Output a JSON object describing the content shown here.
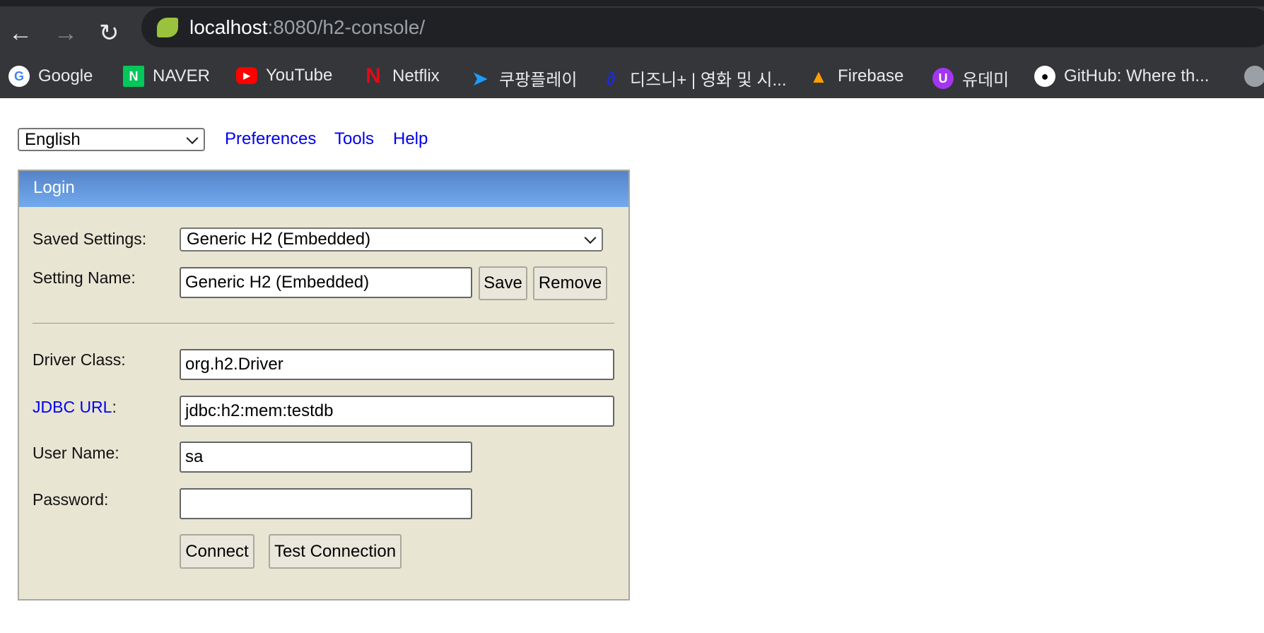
{
  "browser": {
    "url_host": "localhost",
    "url_rest": ":8080/h2-console/",
    "bookmarks": [
      {
        "label": "Google",
        "icon": "google-icon",
        "color": "#ffffff"
      },
      {
        "label": "NAVER",
        "icon": "naver-icon",
        "color": "#03c75a"
      },
      {
        "label": "YouTube",
        "icon": "youtube-icon",
        "color": "#ff0000"
      },
      {
        "label": "Netflix",
        "icon": "netflix-icon",
        "color": "#b20710"
      },
      {
        "label": "쿠팡플레이",
        "icon": "coupang-play-icon",
        "color": "#1e9bff"
      },
      {
        "label": "디즈니+ | 영화 및 시...",
        "icon": "disney-plus-icon",
        "color": "#1a2bd8"
      },
      {
        "label": "Firebase",
        "icon": "firebase-icon",
        "color": "#ffa000"
      },
      {
        "label": "유데미",
        "icon": "udemy-icon",
        "color": "#a435f0"
      },
      {
        "label": "GitHub: Where th...",
        "icon": "github-icon",
        "color": "#ffffff"
      }
    ]
  },
  "toolbar": {
    "language": "English",
    "links": [
      "Preferences",
      "Tools",
      "Help"
    ]
  },
  "login": {
    "title": "Login",
    "saved_settings_label": "Saved Settings:",
    "saved_settings_value": "Generic H2 (Embedded)",
    "setting_name_label": "Setting Name:",
    "setting_name_value": "Generic H2 (Embedded)",
    "save": "Save",
    "remove": "Remove",
    "driver_label": "Driver Class:",
    "driver_value": "org.h2.Driver",
    "jdbc_label": "JDBC URL",
    "jdbc_colon": ":",
    "jdbc_value": "jdbc:h2:mem:testdb",
    "user_label": "User Name:",
    "user_value": "sa",
    "password_label": "Password:",
    "password_value": "",
    "connect": "Connect",
    "test": "Test Connection"
  }
}
